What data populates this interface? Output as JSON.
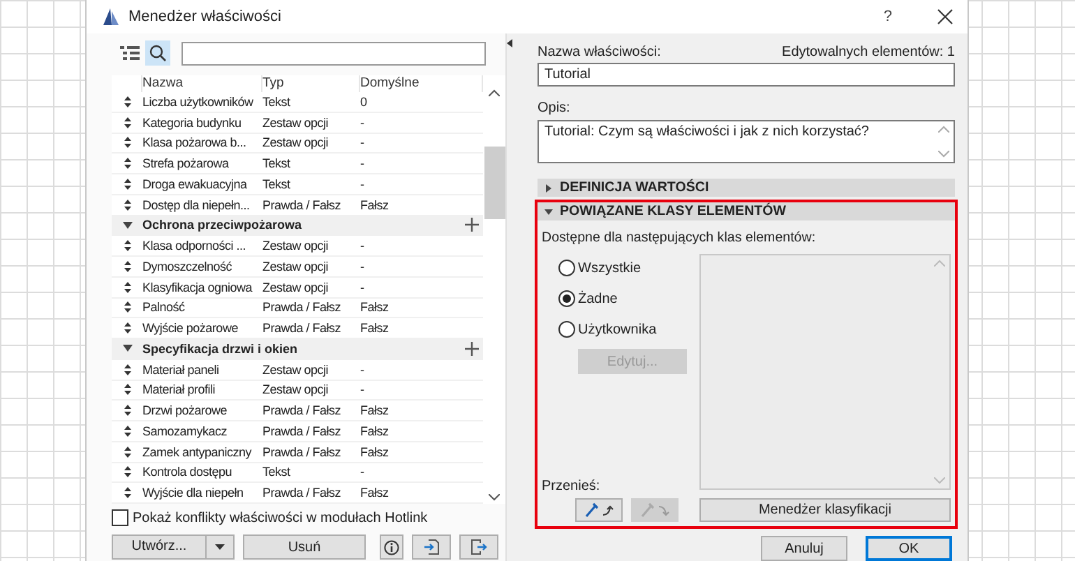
{
  "window": {
    "title": "Menedżer właściwości",
    "help": "?"
  },
  "table": {
    "columns": [
      "Nazwa",
      "Typ",
      "Domyślne"
    ],
    "rows": [
      {
        "kind": "property",
        "name": "Liczba użytkowników",
        "type": "Tekst",
        "default": "0"
      },
      {
        "kind": "property",
        "name": "Kategoria budynku",
        "type": "Zestaw opcji",
        "default": "-"
      },
      {
        "kind": "property",
        "name": "Klasa pożarowa b...",
        "type": "Zestaw opcji",
        "default": "-"
      },
      {
        "kind": "property",
        "name": "Strefa pożarowa",
        "type": "Tekst",
        "default": "-"
      },
      {
        "kind": "property",
        "name": "Droga ewakuacyjna",
        "type": "Tekst",
        "default": "-"
      },
      {
        "kind": "property",
        "name": "Dostęp dla niepełn...",
        "type": "Prawda / Fałsz",
        "default": "Fałsz"
      },
      {
        "kind": "group",
        "name": "Ochrona przeciwpożarowa",
        "expanded": true
      },
      {
        "kind": "property",
        "name": "Klasa odporności ...",
        "type": "Zestaw opcji",
        "default": "-"
      },
      {
        "kind": "property",
        "name": "Dymoszczelność",
        "type": "Zestaw opcji",
        "default": "-"
      },
      {
        "kind": "property",
        "name": "Klasyfikacja ogniowa",
        "type": "Zestaw opcji",
        "default": "-"
      },
      {
        "kind": "property",
        "name": "Palność",
        "type": "Prawda / Fałsz",
        "default": "Fałsz"
      },
      {
        "kind": "property",
        "name": "Wyjście pożarowe",
        "type": "Prawda / Fałsz",
        "default": "Fałsz"
      },
      {
        "kind": "group",
        "name": "Specyfikacja drzwi i okien",
        "expanded": true
      },
      {
        "kind": "property",
        "name": "Materiał paneli",
        "type": "Zestaw opcji",
        "default": "-"
      },
      {
        "kind": "property",
        "name": "Materiał profili",
        "type": "Zestaw opcji",
        "default": "-"
      },
      {
        "kind": "property",
        "name": "Drzwi pożarowe",
        "type": "Prawda / Fałsz",
        "default": "Fałsz"
      },
      {
        "kind": "property",
        "name": "Samozamykacz",
        "type": "Prawda / Fałsz",
        "default": "Fałsz"
      },
      {
        "kind": "property",
        "name": "Zamek antypaniczny",
        "type": "Prawda / Fałsz",
        "default": "Fałsz"
      },
      {
        "kind": "property",
        "name": "Kontrola dostępu",
        "type": "Tekst",
        "default": "-"
      },
      {
        "kind": "property",
        "name": "Wyjście dla niepełn",
        "type": "Prawda / Fałsz",
        "default": "Fałsz"
      }
    ]
  },
  "hotlink_checkbox": {
    "label": "Pokaż konflikty właściwości w modułach Hotlink",
    "checked": false
  },
  "left_buttons": {
    "create": "Utwórz...",
    "delete": "Usuń"
  },
  "details": {
    "name_label": "Nazwa właściwości:",
    "editable_count": "Edytowalnych elementów: 1",
    "name_value": "Tutorial",
    "description_label": "Opis:",
    "description": "Tutorial: Czym są właściwości i jak z nich korzystać?"
  },
  "sections": [
    {
      "title": "DEFINICJA WARTOŚCI",
      "expanded": false,
      "highlighted": false
    },
    {
      "title": "POWIĄZANE KLASY ELEMENTÓW",
      "expanded": true,
      "highlighted": true
    }
  ],
  "classes": {
    "available_label": "Dostępne dla następujących klas elementów:",
    "options": [
      {
        "label": "Wszystkie",
        "selected": false
      },
      {
        "label": "Żadne",
        "selected": true
      },
      {
        "label": "Użytkownika",
        "selected": false
      }
    ],
    "edit_button": {
      "label": "Edytuj...",
      "disabled": true
    },
    "transfer_label": "Przenieś:",
    "transfer_buttons": [
      {
        "disabled": false
      },
      {
        "disabled": true
      }
    ],
    "classification_button": "Menedżer klasyfikacji"
  },
  "footer": [
    {
      "label": "Anuluj",
      "default": false
    },
    {
      "label": "OK",
      "default": true
    }
  ]
}
